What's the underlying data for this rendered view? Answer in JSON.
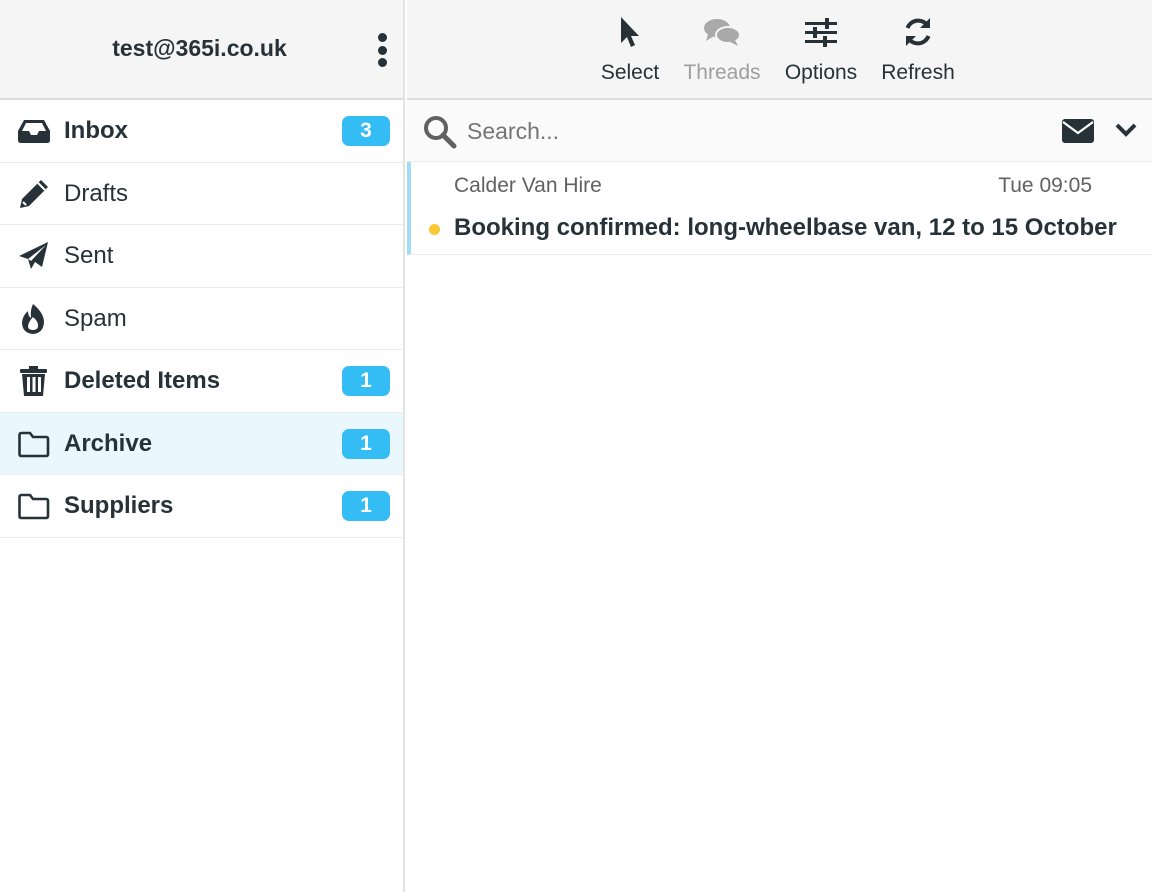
{
  "account": {
    "email": "test@365i.co.uk",
    "menu_icon": "more-vertical-icon"
  },
  "folders": [
    {
      "label": "Inbox",
      "icon": "inbox-icon",
      "unread": "3",
      "bold": true,
      "active": false
    },
    {
      "label": "Drafts",
      "icon": "pencil-icon",
      "unread": "",
      "bold": false,
      "active": false
    },
    {
      "label": "Sent",
      "icon": "paper-plane-icon",
      "unread": "",
      "bold": false,
      "active": false
    },
    {
      "label": "Spam",
      "icon": "flame-icon",
      "unread": "",
      "bold": false,
      "active": false
    },
    {
      "label": "Deleted Items",
      "icon": "trash-icon",
      "unread": "1",
      "bold": true,
      "active": false
    },
    {
      "label": "Archive",
      "icon": "folder-icon",
      "unread": "1",
      "bold": true,
      "active": true
    },
    {
      "label": "Suppliers",
      "icon": "folder-icon",
      "unread": "1",
      "bold": true,
      "active": false
    }
  ],
  "toolbar": {
    "select_label": "Select",
    "threads_label": "Threads",
    "options_label": "Options",
    "refresh_label": "Refresh"
  },
  "search": {
    "placeholder": "Search...",
    "value": ""
  },
  "messages": [
    {
      "from": "Calder Van Hire",
      "time": "Tue 09:05",
      "subject": "Booking confirmed: long-wheelbase van, 12 to 15 October",
      "unread": true
    }
  ],
  "colors": {
    "badge": "#33bdf4",
    "active_folder_bg": "#eaf7fd",
    "unread_dot": "#f9c935",
    "selected_row_border": "#9fdcf6",
    "text": "#263238"
  }
}
